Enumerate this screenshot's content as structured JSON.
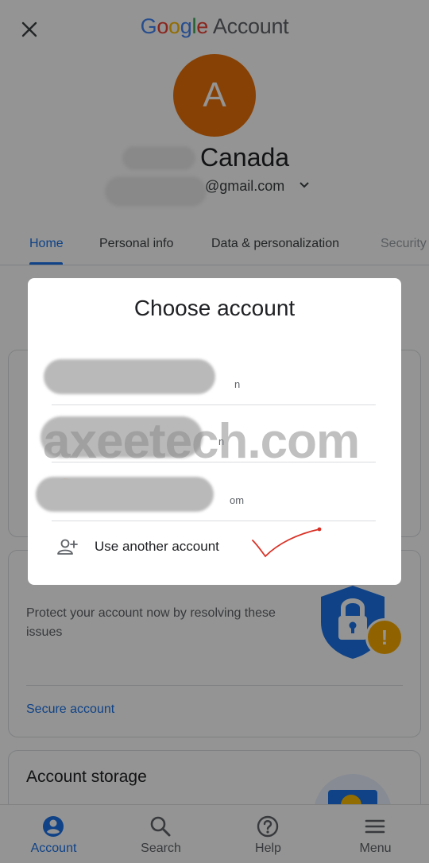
{
  "header": {
    "close_icon": "close-icon",
    "brand_letters": [
      "G",
      "o",
      "o",
      "g",
      "l",
      "e"
    ],
    "brand_suffix": "Account"
  },
  "profile": {
    "avatar_initial": "A",
    "avatar_color": "#e8710a",
    "name_visible": "Canada",
    "email_visible": "@gmail.com",
    "expand_icon": "chevron-down-icon"
  },
  "tabs": [
    {
      "label": "Home",
      "active": true
    },
    {
      "label": "Personal info",
      "active": false
    },
    {
      "label": "Data & personalization",
      "active": false
    },
    {
      "label": "Security",
      "active": false
    }
  ],
  "security_card": {
    "description": "Protect your account now by resolving these issues",
    "link": "Secure account",
    "badge": "!"
  },
  "storage_card": {
    "title": "Account storage"
  },
  "dialog": {
    "title": "Choose account",
    "accounts": [
      {
        "email_tail": "n"
      },
      {
        "email_tail": "n"
      },
      {
        "email_tail": "om"
      }
    ],
    "use_another_label": "Use another account",
    "use_another_icon": "person-add-icon"
  },
  "watermark": "axeetech.com",
  "bottom_nav": [
    {
      "label": "Account",
      "icon": "account-circle-icon",
      "active": true
    },
    {
      "label": "Search",
      "icon": "search-icon",
      "active": false
    },
    {
      "label": "Help",
      "icon": "help-icon",
      "active": false
    },
    {
      "label": "Menu",
      "icon": "menu-icon",
      "active": false
    }
  ],
  "colors": {
    "accent": "#1a73e8",
    "warning": "#f9ab00",
    "annotation": "#d93025"
  }
}
